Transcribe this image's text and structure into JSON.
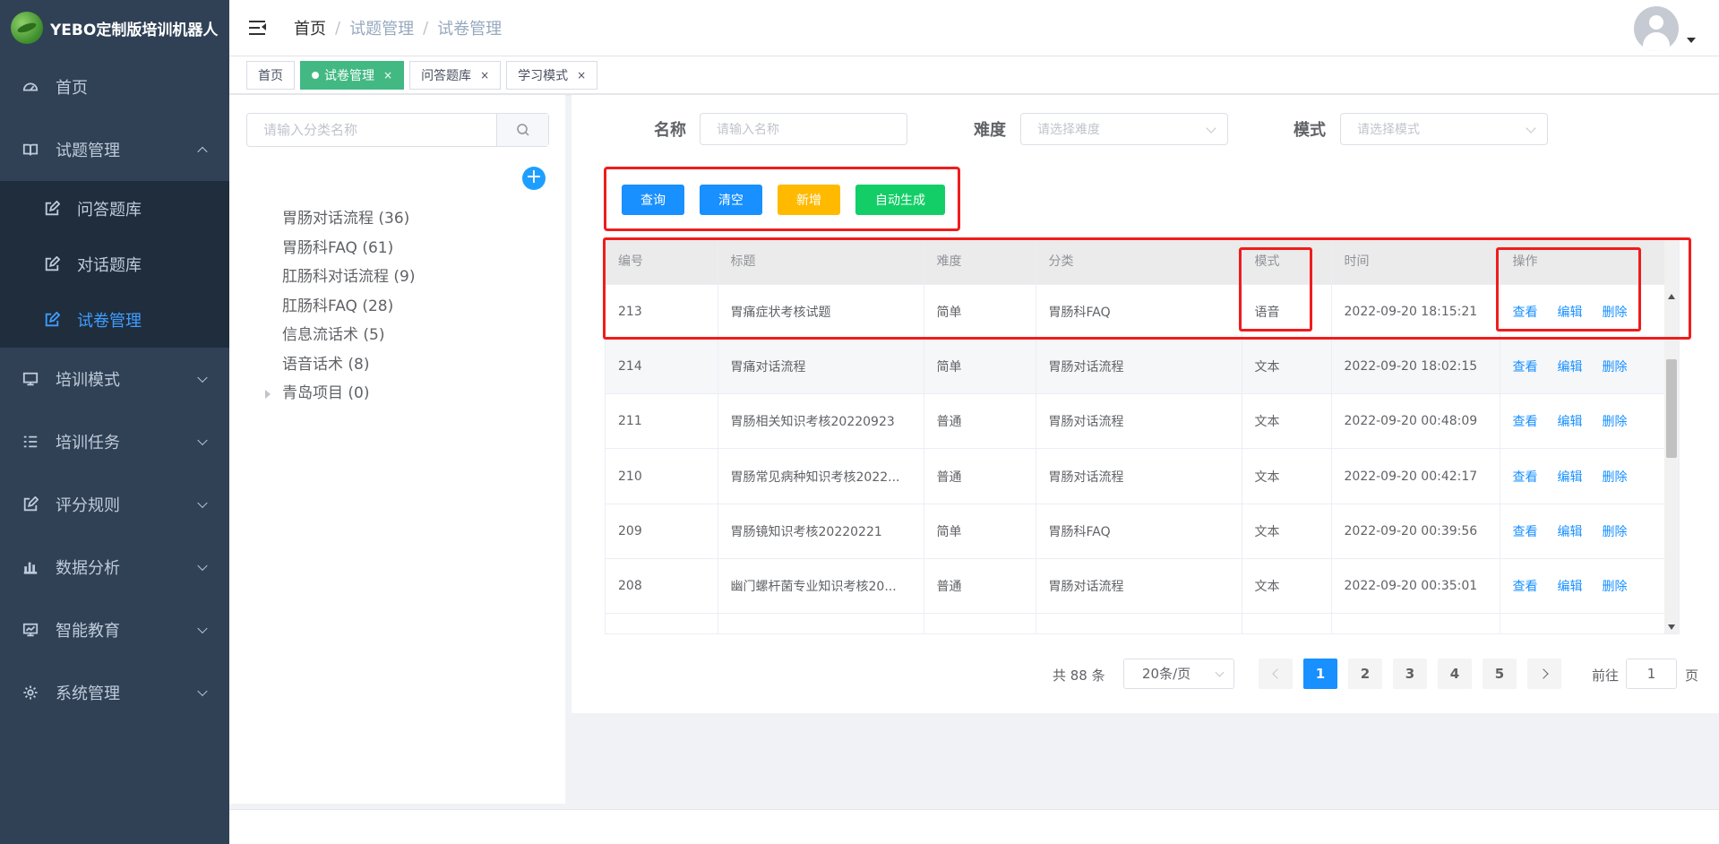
{
  "app": {
    "logo_text": "YEBO定制版培训机器人"
  },
  "sidebar": {
    "items": [
      {
        "label": "首页",
        "icon": "dashboard-icon"
      },
      {
        "label": "试题管理",
        "icon": "book-icon",
        "expanded": true,
        "children": [
          {
            "label": "问答题库",
            "icon": "edit-icon"
          },
          {
            "label": "对话题库",
            "icon": "edit-icon"
          },
          {
            "label": "试卷管理",
            "icon": "edit-icon",
            "active": true
          }
        ]
      },
      {
        "label": "培训模式",
        "icon": "monitor-icon"
      },
      {
        "label": "培训任务",
        "icon": "list-icon"
      },
      {
        "label": "评分规则",
        "icon": "edit-icon"
      },
      {
        "label": "数据分析",
        "icon": "bar-chart-icon"
      },
      {
        "label": "智能教育",
        "icon": "chart-screen-icon"
      },
      {
        "label": "系统管理",
        "icon": "gear-icon"
      }
    ]
  },
  "breadcrumb": [
    "首页",
    "试题管理",
    "试卷管理"
  ],
  "tags": [
    {
      "label": "首页",
      "active": false,
      "closable": false
    },
    {
      "label": "试卷管理",
      "active": true,
      "closable": true
    },
    {
      "label": "问答题库",
      "active": false,
      "closable": true
    },
    {
      "label": "学习模式",
      "active": false,
      "closable": true
    }
  ],
  "tree": {
    "search_placeholder": "请输入分类名称",
    "nodes": [
      {
        "label": "胃肠对话流程 (36)",
        "expandable": false
      },
      {
        "label": "胃肠科FAQ (61)",
        "expandable": false
      },
      {
        "label": "肛肠科对话流程 (9)",
        "expandable": false
      },
      {
        "label": "肛肠科FAQ (28)",
        "expandable": false
      },
      {
        "label": "信息流话术 (5)",
        "expandable": false
      },
      {
        "label": "语音话术 (8)",
        "expandable": false
      },
      {
        "label": "青岛项目 (0)",
        "expandable": true
      }
    ]
  },
  "filters": {
    "name_label": "名称",
    "name_placeholder": "请输入名称",
    "difficulty_label": "难度",
    "difficulty_placeholder": "请选择难度",
    "mode_label": "模式",
    "mode_placeholder": "请选择模式"
  },
  "actions": {
    "query": "查询",
    "clear": "清空",
    "add": "新增",
    "auto_generate": "自动生成"
  },
  "table": {
    "headers": [
      "编号",
      "标题",
      "难度",
      "分类",
      "模式",
      "时间",
      "操作"
    ],
    "row_actions": [
      "查看",
      "编辑",
      "删除"
    ],
    "rows": [
      [
        "213",
        "胃痛症状考核试题",
        "简单",
        "胃肠科FAQ",
        "语音",
        "2022-09-20 18:15:21"
      ],
      [
        "214",
        "胃痛对话流程",
        "简单",
        "胃肠对话流程",
        "文本",
        "2022-09-20 18:02:15"
      ],
      [
        "211",
        "胃肠相关知识考核20220923",
        "普通",
        "胃肠对话流程",
        "文本",
        "2022-09-20 00:48:09"
      ],
      [
        "210",
        "胃肠常见病种知识考核2022...",
        "普通",
        "胃肠对话流程",
        "文本",
        "2022-09-20 00:42:17"
      ],
      [
        "209",
        "胃肠镜知识考核20220221",
        "简单",
        "胃肠科FAQ",
        "文本",
        "2022-09-20 00:39:56"
      ],
      [
        "208",
        "幽门螺杆菌专业知识考核20...",
        "普通",
        "胃肠对话流程",
        "文本",
        "2022-09-20 00:35:01"
      ]
    ]
  },
  "pagination": {
    "total_text": "共 88 条",
    "page_size": "20条/页",
    "pages": [
      "1",
      "2",
      "3",
      "4",
      "5"
    ],
    "current": "1",
    "goto_label": "前往",
    "goto_value": "1",
    "page_suffix": "页"
  },
  "colors": {
    "sidebar_bg": "#304156",
    "primary": "#1890ff",
    "tag_active": "#42b983",
    "btn_query": "#1890ff",
    "btn_clear": "#1890ff",
    "btn_add": "#ffba00",
    "btn_auto": "#13ce66",
    "highlight": "#f01c1c"
  }
}
